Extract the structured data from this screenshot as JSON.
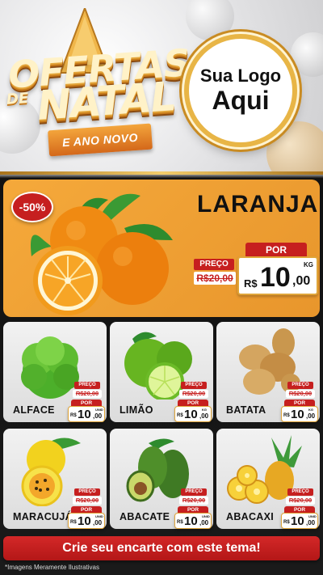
{
  "header": {
    "title_line1": "OFERTAS",
    "title_de": "DE",
    "title_line2": "NATAL",
    "ribbon": "E ANO NOVO",
    "logo_line1": "Sua Logo",
    "logo_line2": "Aqui"
  },
  "featured": {
    "discount": "-50%",
    "name": "LARANJA",
    "price_label": "PREÇO",
    "old_price": "R$20,00",
    "por_label": "POR",
    "currency": "R$",
    "price_int": "10",
    "price_cents": ",00",
    "unit": "KG"
  },
  "products": [
    {
      "name": "ALFACE",
      "price_label": "PREÇO",
      "old_price": "R$20,00",
      "por_label": "POR",
      "currency": "R$",
      "price_int": "10",
      "price_cents": ",00",
      "unit": "UNID"
    },
    {
      "name": "LIMÃO",
      "price_label": "PREÇO",
      "old_price": "R$20,00",
      "por_label": "POR",
      "currency": "R$",
      "price_int": "10",
      "price_cents": ",00",
      "unit": "KG"
    },
    {
      "name": "BATATA",
      "price_label": "PREÇO",
      "old_price": "R$20,00",
      "por_label": "POR",
      "currency": "R$",
      "price_int": "10",
      "price_cents": ",00",
      "unit": "KG"
    },
    {
      "name": "MARACUJÁ",
      "price_label": "PREÇO",
      "old_price": "R$20,00",
      "por_label": "POR",
      "currency": "R$",
      "price_int": "10",
      "price_cents": ",00",
      "unit": "UNID"
    },
    {
      "name": "ABACATE",
      "price_label": "PREÇO",
      "old_price": "R$20,00",
      "por_label": "POR",
      "currency": "R$",
      "price_int": "10",
      "price_cents": ",00",
      "unit": "UNID"
    },
    {
      "name": "ABACAXI",
      "price_label": "PREÇO",
      "old_price": "R$20,00",
      "por_label": "POR",
      "currency": "R$",
      "price_int": "10",
      "price_cents": ",00",
      "unit": "UNID"
    }
  ],
  "cta": "Crie seu encarte com este tema!",
  "disclaimer": "*Imagens Meramente Ilustrativas",
  "colors": {
    "accent_red": "#c61f1f",
    "featured_bg": "#f5a93b",
    "gold": "#e8b546"
  }
}
